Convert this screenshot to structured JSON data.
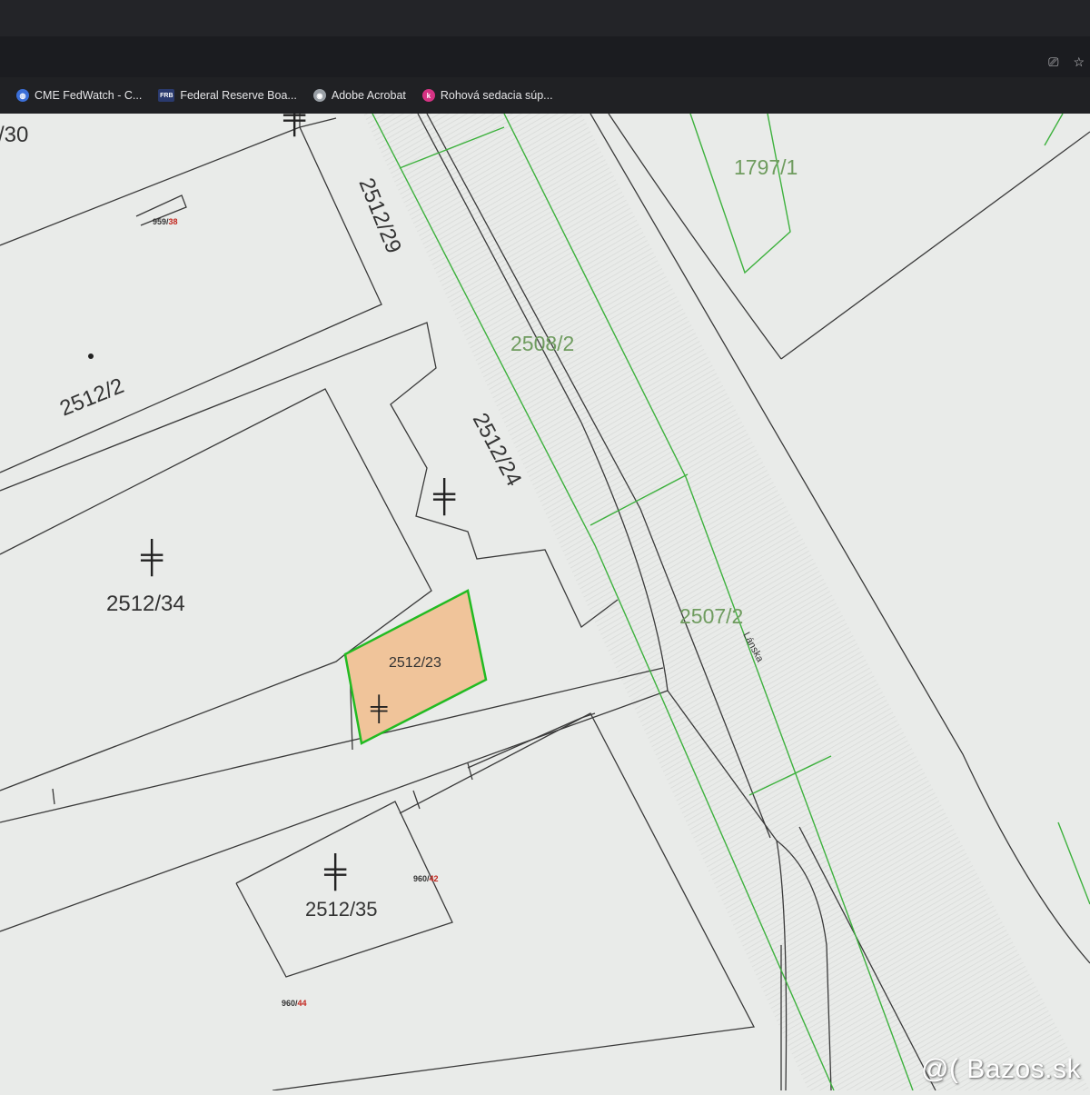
{
  "bookmarks": [
    {
      "label": "CME FedWatch - C...",
      "icon": "globe-icon"
    },
    {
      "label": "Federal Reserve Boa...",
      "icon": "frb-icon"
    },
    {
      "label": "Adobe Acrobat",
      "icon": "acrobat-icon"
    },
    {
      "label": "Rohová sedacia súp...",
      "icon": "shop-icon"
    }
  ],
  "map": {
    "parcels": {
      "p30": "/30",
      "p2512_29": "2512/29",
      "p1797_1": "1797/1",
      "p2512_2": "2512/2",
      "p2508_2": "2508/2",
      "p2512_24": "2512/24",
      "p2512_34": "2512/34",
      "p2507_2": "2507/2",
      "p2512_23": "2512/23",
      "p2512_35": "2512/35"
    },
    "building_refs": {
      "r959_38_a": "959/",
      "r959_38_b": "38",
      "r960_42_a": "960/",
      "r960_42_b": "42",
      "r960_44_a": "960/",
      "r960_44_b": "44"
    },
    "street": "Lánska",
    "building_symbol": "╪",
    "highlight_color": "#f0c49a",
    "highlight_border": "#22bb22"
  },
  "watermark": "@( Bazos.sk"
}
